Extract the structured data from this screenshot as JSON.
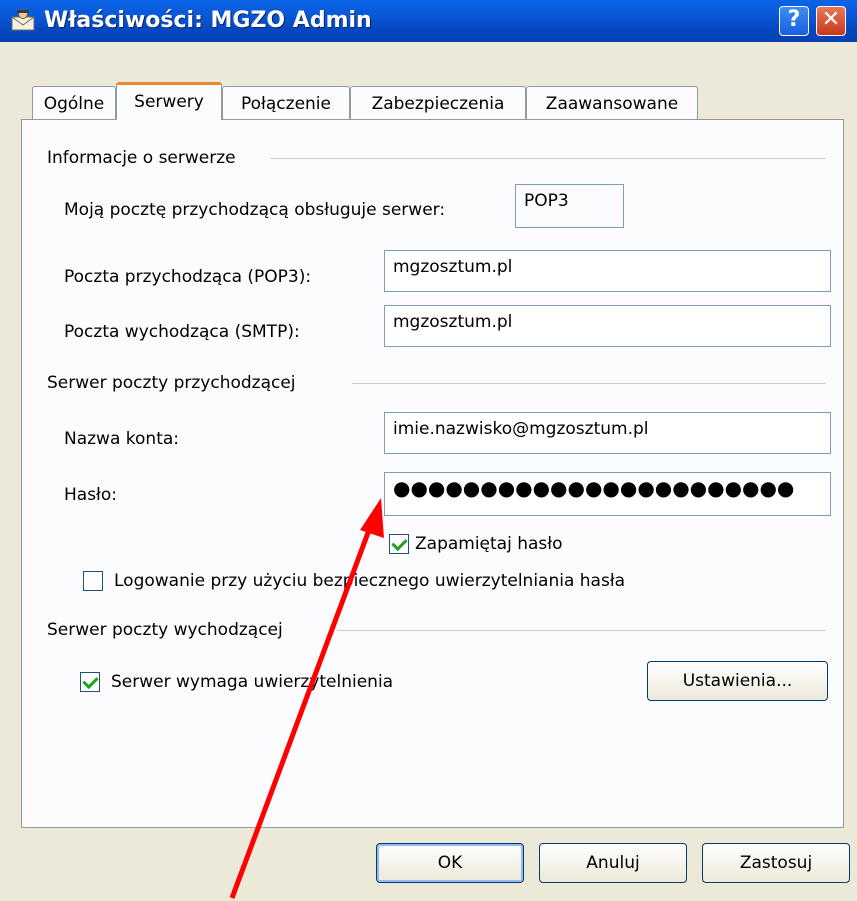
{
  "window": {
    "title": "Właściwości: MGZO Admin",
    "help_glyph": "?",
    "close_glyph": "✕"
  },
  "tabs": [
    {
      "label": "Ogólne"
    },
    {
      "label": "Serwery"
    },
    {
      "label": "Połączenie"
    },
    {
      "label": "Zabezpieczenia"
    },
    {
      "label": "Zaawansowane"
    }
  ],
  "server_info": {
    "group_label": "Informacje o serwerze",
    "incoming_type_label": "Moją pocztę przychodzącą obsługuje serwer:",
    "incoming_type_value": "POP3",
    "incoming_label": "Poczta przychodząca (POP3):",
    "incoming_value": "mgzosztum.pl",
    "outgoing_label": "Poczta wychodząca (SMTP):",
    "outgoing_value": "mgzosztum.pl"
  },
  "incoming_server": {
    "group_label": "Serwer poczty przychodzącej",
    "account_label": "Nazwa konta:",
    "account_value": "imie.nazwisko@mgzosztum.pl",
    "password_label": "Hasło:",
    "password_value": "●●●●●●●●●●●●●●●●●●●●●●●",
    "remember_label": "Zapamiętaj hasło",
    "remember_checked": true,
    "spa_label": "Logowanie przy użyciu bezpiecznego uwierzytelniania hasła",
    "spa_checked": false
  },
  "outgoing_server": {
    "group_label": "Serwer poczty wychodzącej",
    "auth_label": "Serwer wymaga uwierzytelnienia",
    "auth_checked": true,
    "settings_button": "Ustawienia..."
  },
  "buttons": {
    "ok": "OK",
    "cancel": "Anuluj",
    "apply": "Zastosuj"
  },
  "colors": {
    "titlebar": "#0958d8",
    "face": "#ece9d8",
    "tab_highlight": "#e68b2c",
    "annotation_arrow": "#ff0000"
  }
}
